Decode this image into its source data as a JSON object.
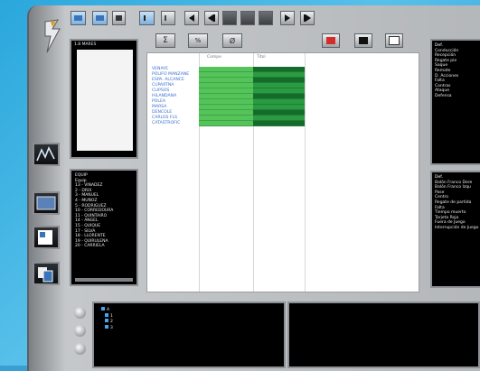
{
  "left_top_panel": {
    "title": "1.8 MARES"
  },
  "left_list": {
    "title": "EQUIP",
    "subtitle": "Equip",
    "items": [
      "13 - VINADEZ",
      "2 - DRIX",
      "3 - MANUEL",
      "4 - MUÑOZ",
      "5 - RODRIGUEZ",
      "10 - CORREDOURA",
      "11 - QUINTAIRO",
      "14 - ANGEL",
      "15 - QUIQUE",
      "17 - SILVA",
      "18 - LLORENTE",
      "19 - QUIRULENA",
      "20 - CARRIELA"
    ]
  },
  "grid": {
    "col_headers": [
      "Compe",
      "Titol"
    ],
    "rows": [
      "VENAYE",
      "POLIFO MANZANE",
      "ESPA. ALCANCE",
      "CUPARTNA",
      "CLIPSOS",
      "HILANDANA",
      "POLEA",
      "MARSA",
      "DENCOLE",
      "CARLOS FLS",
      "CATASTROFIC"
    ]
  },
  "right_top_list": {
    "title": "Def.",
    "items": [
      "Conducción",
      "Recepción",
      "Regate pie",
      "Saque",
      "Remate",
      "D. Acciones",
      "Falta",
      "Contras",
      "Ataque",
      "Defensa"
    ]
  },
  "right_bottom_list": {
    "title": "Def.",
    "items": [
      "Balón Franco Dere",
      "Balón Franco Izqu",
      "Pase",
      "Centro",
      "Regate de partida",
      "Falta",
      "Tiempo muerto",
      "Tarjeta Roja",
      "Fuera de Juego",
      "Interrupción de Juego"
    ]
  },
  "bottom_tree": {
    "items": [
      "A",
      "1",
      "2",
      "3"
    ]
  }
}
